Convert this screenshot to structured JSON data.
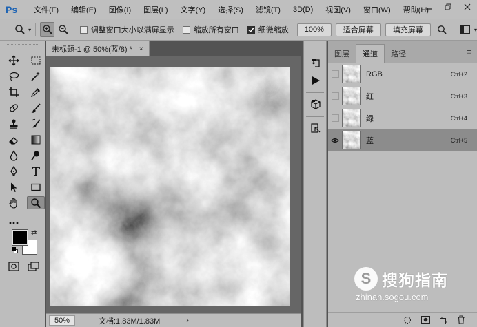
{
  "app": {
    "logo": "Ps"
  },
  "menu": [
    "文件(F)",
    "编辑(E)",
    "图像(I)",
    "图层(L)",
    "文字(Y)",
    "选择(S)",
    "滤镜(T)",
    "3D(D)",
    "视图(V)",
    "窗口(W)",
    "帮助(H)"
  ],
  "options": {
    "checkbox_resize": "调整窗口大小以满屏显示",
    "checkbox_zoom_all": "缩放所有窗口",
    "checkbox_scrubby": "细微缩放",
    "zoom_button": "100%",
    "fit_screen": "适合屏幕",
    "fill_screen": "填充屏幕"
  },
  "document": {
    "tab_title": "未标题-1 @ 50%(蓝/8) *",
    "tab_close": "×",
    "zoom": "50%",
    "doc_info": "文档:1.83M/1.83M",
    "status_arrow": "›"
  },
  "panel": {
    "tabs": [
      "图层",
      "通道",
      "路径"
    ],
    "active_tab": 1,
    "channels": [
      {
        "name": "RGB",
        "shortcut": "Ctrl+2",
        "visible": false,
        "selected": false
      },
      {
        "name": "红",
        "shortcut": "Ctrl+3",
        "visible": false,
        "selected": false
      },
      {
        "name": "绿",
        "shortcut": "Ctrl+4",
        "visible": false,
        "selected": false
      },
      {
        "name": "蓝",
        "shortcut": "Ctrl+5",
        "visible": true,
        "selected": true
      }
    ]
  },
  "watermark": {
    "title": "搜狗指南",
    "url": "zhinan.sogou.com"
  },
  "colors": {
    "foreground": "#000000",
    "background": "#ffffff",
    "ui_bg": "#bdbdbd"
  }
}
